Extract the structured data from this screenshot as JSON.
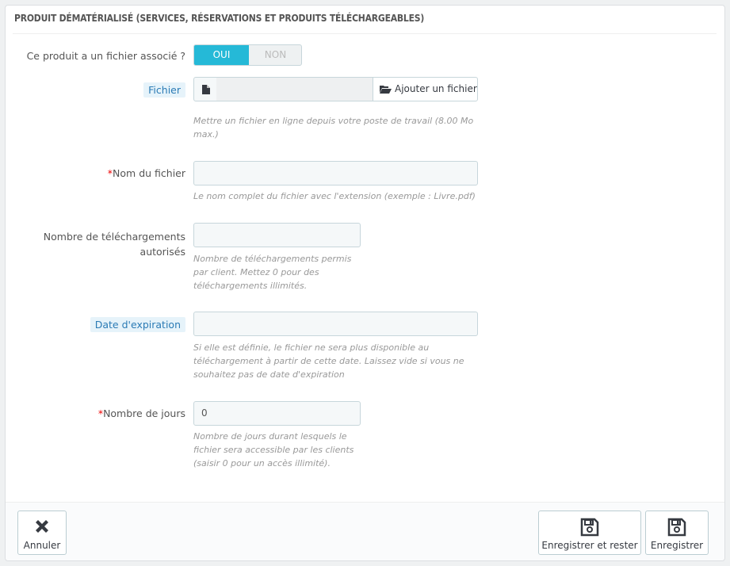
{
  "panel": {
    "title": "PRODUIT DÉMATÉRIALISÉ (SERVICES, RÉSERVATIONS ET PRODUITS TÉLÉCHARGEABLES)"
  },
  "fields": {
    "has_file": {
      "label": "Ce produit a un fichier associé ?",
      "on_label": "OUI",
      "off_label": "NON",
      "selected": "OUI"
    },
    "file": {
      "label": "Fichier",
      "button_label": "Ajouter un fichier",
      "help": "Mettre un fichier en ligne depuis votre poste de travail (8.00 Mo max.)"
    },
    "file_name": {
      "required_mark": "*",
      "label": "Nom du fichier",
      "value": "",
      "help": "Le nom complet du fichier avec l'extension (exemple : Livre.pdf)"
    },
    "downloads": {
      "label": "Nombre de téléchargements autorisés",
      "value": "",
      "help": "Nombre de téléchargements permis par client. Mettez 0 pour des téléchargements illimités."
    },
    "expiration": {
      "label": "Date d'expiration",
      "value": "",
      "help": "Si elle est définie, le fichier ne sera plus disponible au téléchargement à partir de cette date. Laissez vide si vous ne souhaitez pas de date d'expiration"
    },
    "days": {
      "required_mark": "*",
      "label": "Nombre de jours",
      "value": "0",
      "help": "Nombre de jours durant lesquels le fichier sera accessible par les clients (saisir 0 pour un accès illimité)."
    }
  },
  "footer": {
    "cancel_label": "Annuler",
    "save_stay_label": "Enregistrer et rester",
    "save_label": "Enregistrer"
  },
  "colors": {
    "accent": "#25b9d7",
    "hint_bg": "#e6f3fa",
    "hint_text": "#2b7bb5",
    "required": "#e00000"
  },
  "icons": {
    "file": "file-icon",
    "folder_open": "folder-open-icon",
    "cancel": "close-icon",
    "save": "floppy-disk-icon"
  }
}
